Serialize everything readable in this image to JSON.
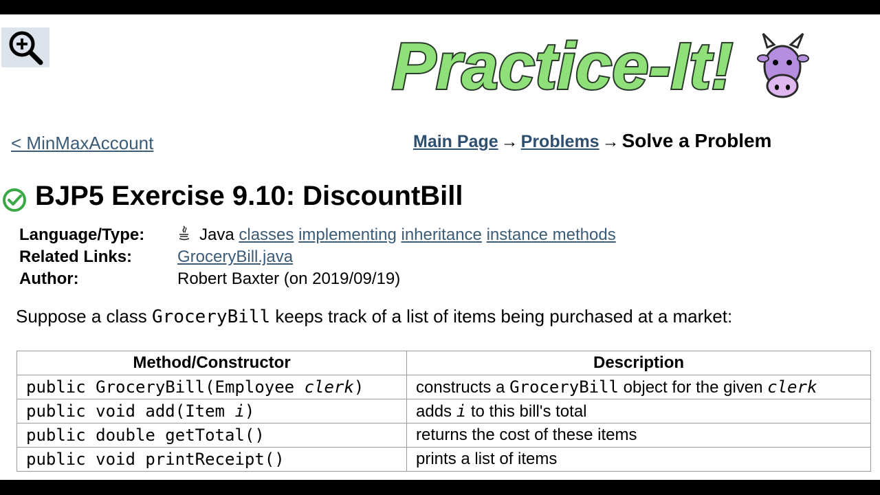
{
  "zoom_button": {
    "icon": "zoom-in-icon"
  },
  "logo": {
    "text": "Practice-It!",
    "icon": "cow-mascot-icon",
    "color": "#90e07a"
  },
  "nav": {
    "back_link": "< MinMaxAccount",
    "breadcrumb": {
      "main_page": "Main Page",
      "arrow1": "→",
      "problems": "Problems",
      "arrow2": "→",
      "current": "Solve a Problem"
    }
  },
  "problem": {
    "status_icon": "check-circle-icon",
    "status_color": "#3aa845",
    "title": "BJP5 Exercise 9.10: DiscountBill",
    "meta": {
      "language_label": "Language/Type:",
      "language": "Java",
      "tags": [
        "classes",
        "implementing",
        "inheritance",
        "instance methods"
      ],
      "related_label": "Related Links:",
      "related_link": "GroceryBill.java",
      "author_label": "Author:",
      "author": "Robert Baxter (on 2019/09/19)"
    },
    "intro": {
      "before": "Suppose a class ",
      "class_name": "GroceryBill",
      "after": " keeps track of a list of items being purchased at a market:"
    },
    "table": {
      "headers": [
        "Method/Constructor",
        "Description"
      ],
      "rows": [
        {
          "code": "public GroceryBill(Employee ",
          "param": "clerk",
          "code_end": ")",
          "desc_before": "constructs a ",
          "desc_code": "GroceryBill",
          "desc_mid": " object for the given ",
          "desc_param": "clerk"
        },
        {
          "code": "public void add(Item ",
          "param": "i",
          "code_end": ")",
          "desc_before": "adds ",
          "desc_param": "i",
          "desc_after": " to this bill's total"
        },
        {
          "code": "public double getTotal()",
          "desc": "returns the cost of these items"
        },
        {
          "code": "public void printReceipt()",
          "desc": "prints a list of items"
        }
      ]
    }
  }
}
